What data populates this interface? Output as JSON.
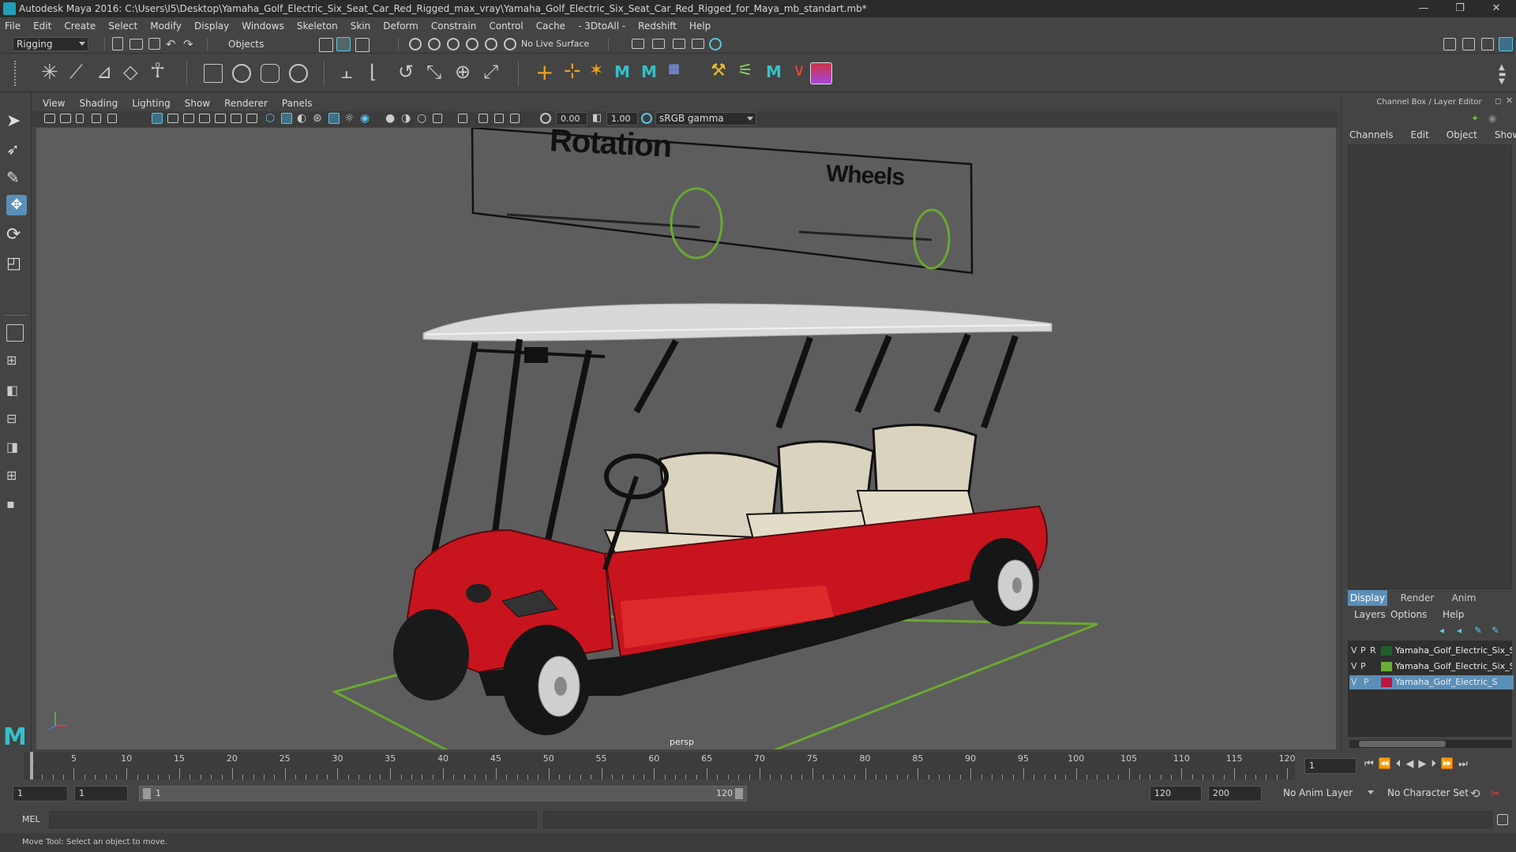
{
  "window": {
    "title": "Autodesk Maya 2016: C:\\Users\\I5\\Desktop\\Yamaha_Golf_Electric_Six_Seat_Car_Red_Rigged_max_vray\\Yamaha_Golf_Electric_Six_Seat_Car_Red_Rigged_for_Maya_mb_standart.mb*",
    "minimize": "—",
    "restore": "❐",
    "close": "✕"
  },
  "menubar": [
    "File",
    "Edit",
    "Create",
    "Select",
    "Modify",
    "Display",
    "Windows",
    "Skeleton",
    "Skin",
    "Deform",
    "Constrain",
    "Control",
    "Cache",
    "- 3DtoAll -",
    "Redshift",
    "Help"
  ],
  "status": {
    "menuset": "Rigging",
    "select_mode": "Objects",
    "live_surface": "No Live Surface"
  },
  "viewport": {
    "menu": [
      "View",
      "Shading",
      "Lighting",
      "Show",
      "Renderer",
      "Panels"
    ],
    "exposure": "0.00",
    "gamma": "1.00",
    "colorspace": "sRGB gamma",
    "camera": "persp",
    "panel_rotation": "Rotation",
    "panel_wheels": "Wheels"
  },
  "channelbox": {
    "header": "Channel Box / Layer Editor",
    "tabs": [
      "Channels",
      "Edit",
      "Object",
      "Show"
    ]
  },
  "layers": {
    "tabs": [
      "Display",
      "Render",
      "Anim"
    ],
    "menu": [
      "Layers",
      "Options",
      "Help"
    ],
    "rows": [
      {
        "v": "V",
        "p": "P",
        "r": "R",
        "name": "Yamaha_Golf_Electric_Six_Sea",
        "color": "#1e5e2a",
        "selected": false
      },
      {
        "v": "V",
        "p": "P",
        "r": "",
        "name": "Yamaha_Golf_Electric_Six_Sea",
        "color": "#66b033",
        "selected": false
      },
      {
        "v": "V",
        "p": "P",
        "r": "",
        "name": "Yamaha_Golf_Electric_S",
        "color": "#b8163a",
        "selected": true
      }
    ]
  },
  "timeslider": {
    "ticks": [
      "1",
      "5",
      "10",
      "15",
      "20",
      "25",
      "30",
      "35",
      "40",
      "45",
      "50",
      "55",
      "60",
      "65",
      "70",
      "75",
      "80",
      "85",
      "90",
      "95",
      "100",
      "105",
      "110",
      "115",
      "120"
    ],
    "current_frame": "1",
    "range_start": "1",
    "playback_start": "1",
    "range_bar_start": "1",
    "range_bar_end": "120",
    "playback_end": "120",
    "range_end": "200",
    "anim_layer": "No Anim Layer",
    "character_set": "No Character Set"
  },
  "cmdline": {
    "label": "MEL",
    "help": "Move Tool: Select an object to move."
  },
  "colors": {
    "accent": "#5cc6e6",
    "viewport_bg": "#5d5d5d",
    "ring_green": "#6aa832",
    "car_red": "#c8141e"
  }
}
